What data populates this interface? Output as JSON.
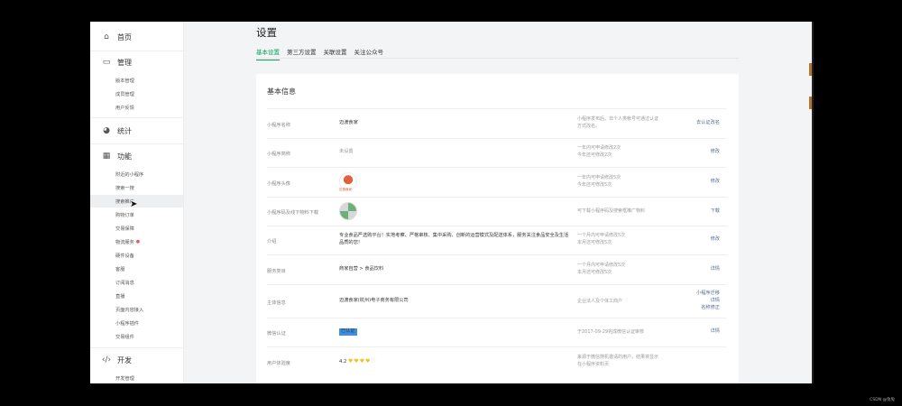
{
  "sidebar": {
    "groups": [
      {
        "label": "首页",
        "icon": "home-icon",
        "glyph": "⌂"
      },
      {
        "label": "管理",
        "icon": "inbox-icon",
        "glyph": "▭"
      },
      {
        "label": "统计",
        "icon": "pie-chart-icon",
        "glyph": "◕"
      },
      {
        "label": "功能",
        "icon": "grid-icon",
        "glyph": "▦"
      },
      {
        "label": "开发",
        "icon": "code-icon",
        "glyph": "‹/›"
      }
    ],
    "manage_items": [
      "版本管理",
      "成员管理",
      "用户反馈"
    ],
    "feature_items": [
      "附近的小程序",
      "搜索一搜",
      "搜索推广",
      "购物订单",
      "交易保障",
      "物流服务",
      "硬件设备",
      "客服",
      "订阅消息",
      "直播",
      "页面内容接入",
      "小程序插件",
      "交易组件"
    ],
    "dev_items": [
      "开发管理"
    ]
  },
  "page": {
    "title": "设置",
    "tabs": [
      "基本设置",
      "第三方设置",
      "关联设置",
      "关注公众号"
    ],
    "card_title": "基本信息"
  },
  "rows": {
    "name": {
      "label": "小程序名称",
      "value": "迈渡食家",
      "note1": "小程序发布后，非个人类帐号可通过认证",
      "note2": "方式改名。",
      "action": "去认证改名"
    },
    "intro_name": {
      "label": "小程序简称",
      "value": "未设置",
      "note1": "一年内可申请修改2次",
      "note2": "今年还可修改2次",
      "action": "修改"
    },
    "avatar": {
      "label": "小程序头像",
      "logo_text": "迈渡食家",
      "note1": "一年内可申请修改5次",
      "note2": "今年还可修改5次",
      "action": "修改"
    },
    "qrcode": {
      "label": "小程序码及线下物料下载",
      "note1": "可下载小程序码及搜索框推广物料",
      "action": "下载"
    },
    "desc": {
      "label": "介绍",
      "value1": "专业食品严选购平台！实地考察、严格审核、集中采购、创新的运营模式及配送体系，服务关注",
      "value2": "食品安全及生活品质的您！",
      "note1": "一个月内可申请修改5次",
      "note2": "本月还可修改5次",
      "action": "修改"
    },
    "category": {
      "label": "服务类目",
      "value": "商家自营 > 食品饮料",
      "note1": "一个月内可申请修改5次",
      "note2": "本月还可修改5次",
      "action": "详情"
    },
    "subject": {
      "label": "主体信息",
      "value": "迈渡食家(杭州)电子商务有限公司",
      "note1": "企业法人及个体工商户",
      "action1": "小程序迁移",
      "action2": "详情",
      "action3": "名称修正"
    },
    "verify": {
      "label": "微信认证",
      "value": "已认证",
      "note1": "于2017-09-29完成微信认证审核",
      "action": "详情"
    },
    "rating": {
      "label": "用户体验度",
      "value": "4.2",
      "note1": "来源于微信随机邀请的用户，结果将显示",
      "note2": "在小程序资料页"
    }
  },
  "watermark": "CSDN @兔兔"
}
